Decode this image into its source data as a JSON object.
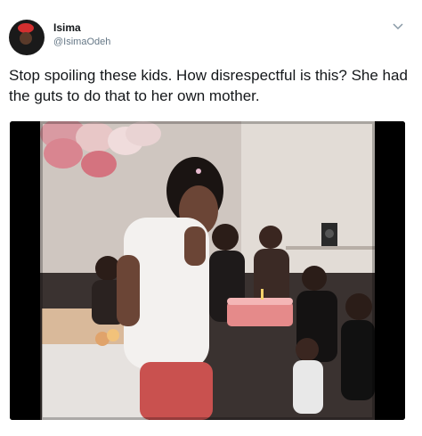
{
  "tweet": {
    "author": {
      "display_name": "Isima",
      "handle": "@IsimaOdeh"
    },
    "text": "Stop spoiling these kids. How disrespectful is this? She had the guts to do that to her own mother.",
    "menu_icon": "chevron-down-icon",
    "media": {
      "type": "video-still",
      "scene": "party-room"
    }
  },
  "colors": {
    "text": "#14171a",
    "secondary": "#657786",
    "avatar_accent": "#d32f2f"
  }
}
